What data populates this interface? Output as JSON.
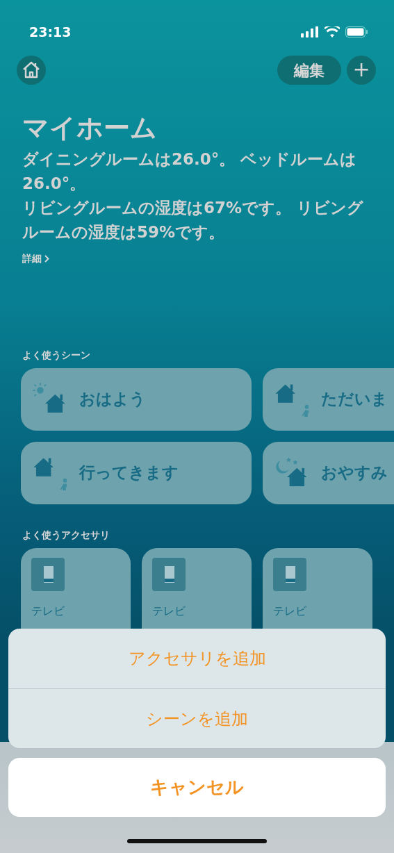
{
  "status_bar": {
    "time": "23:13"
  },
  "toolbar": {
    "edit_button": "編集",
    "add_button": "+"
  },
  "title": "マイホーム",
  "summary": [
    "ダイニングルームは26.0°。 ベッドルームは26.0°。",
    "リビングルームの湿度は67%です。 リビングルームの湿度は59%です。"
  ],
  "details_link": "詳細",
  "scenes": {
    "heading": "よく使うシーン",
    "items": [
      {
        "name": "おはよう",
        "kind": "morning"
      },
      {
        "name": "ただいま",
        "kind": "arrive"
      },
      {
        "name": "行ってきます",
        "kind": "leave"
      },
      {
        "name": "おやすみ",
        "kind": "night"
      }
    ]
  },
  "accessories": {
    "heading": "よく使うアクセサリ",
    "items": [
      {
        "room": "テレビ"
      },
      {
        "room": "テレビ"
      },
      {
        "room": "テレビ"
      }
    ]
  },
  "action_sheet": {
    "actions": [
      "アクセサリを追加",
      "シーンを追加"
    ],
    "cancel": "キャンセル"
  }
}
